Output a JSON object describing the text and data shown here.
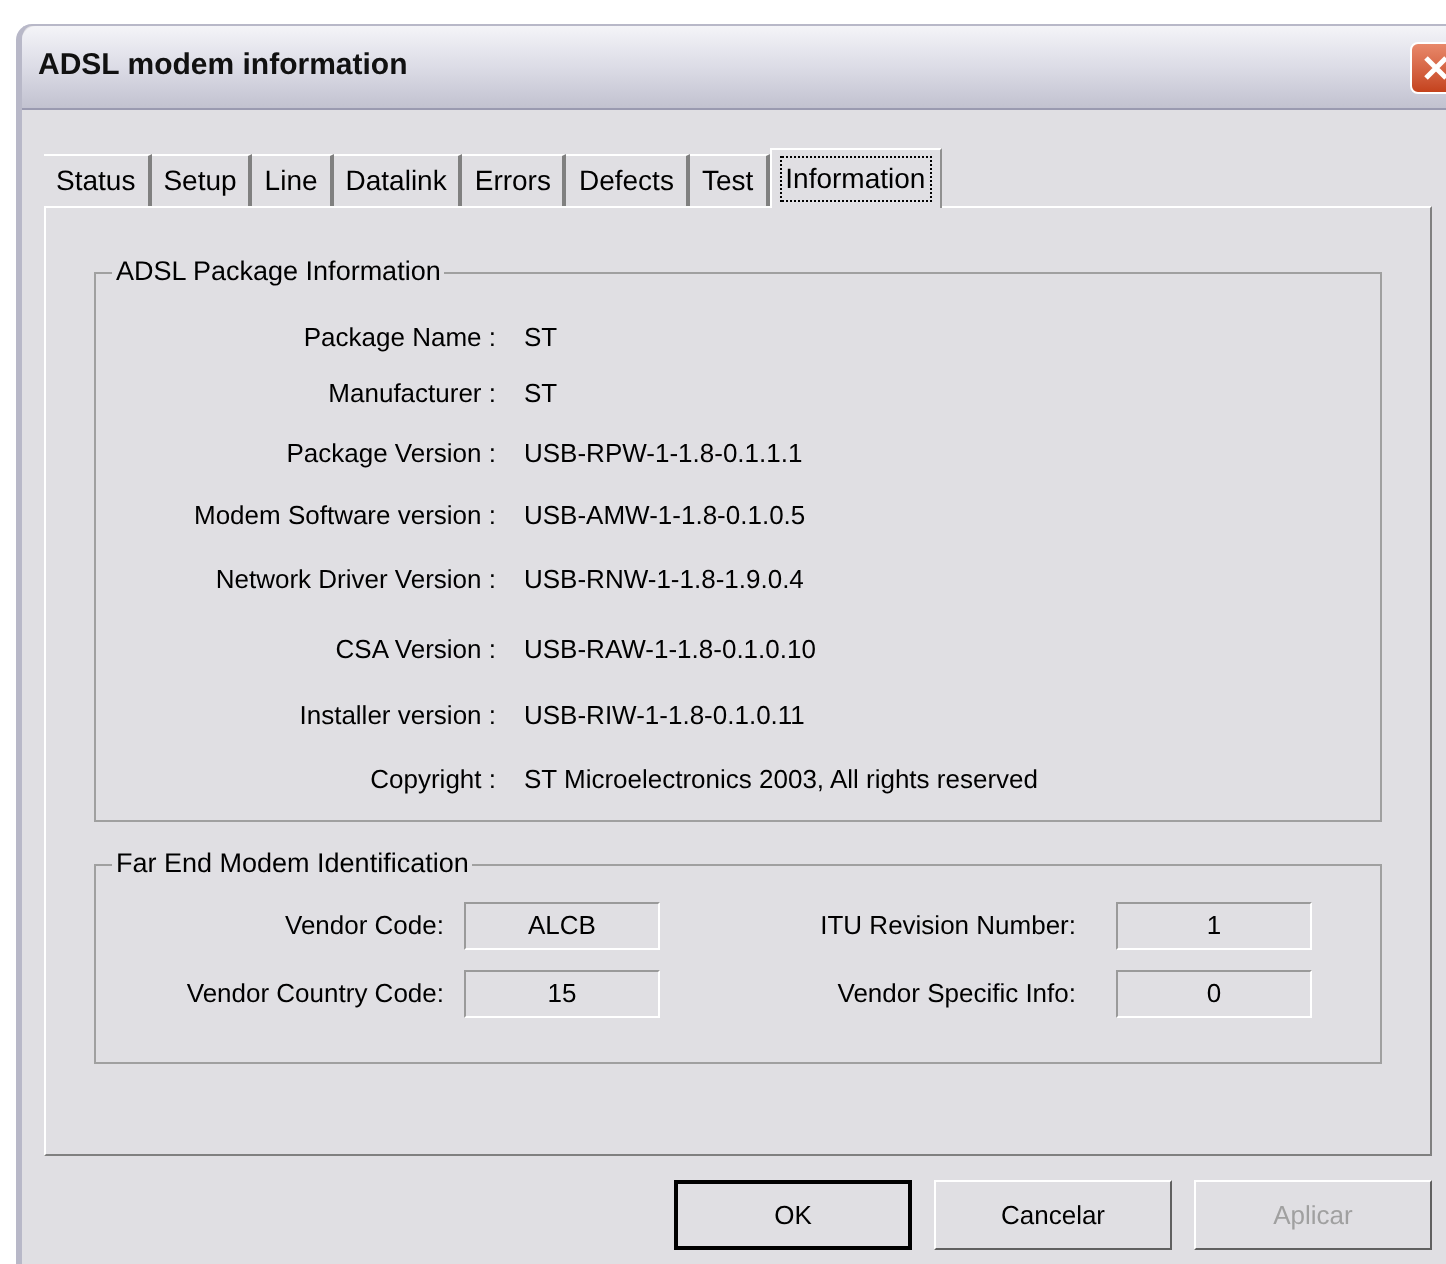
{
  "window": {
    "title": "ADSL modem information"
  },
  "tabs": [
    {
      "label": "Status",
      "selected": false
    },
    {
      "label": "Setup",
      "selected": false
    },
    {
      "label": "Line",
      "selected": false
    },
    {
      "label": "Datalink",
      "selected": false
    },
    {
      "label": "Errors",
      "selected": false
    },
    {
      "label": "Defects",
      "selected": false
    },
    {
      "label": "Test",
      "selected": false
    },
    {
      "label": "Information",
      "selected": true
    }
  ],
  "package_group": {
    "title": "ADSL Package Information",
    "rows": [
      {
        "label": "Package Name :",
        "value": "ST"
      },
      {
        "label": "Manufacturer :",
        "value": "ST"
      },
      {
        "label": "Package Version :",
        "value": "USB-RPW-1-1.8-0.1.1.1"
      },
      {
        "label": "Modem Software version :",
        "value": "USB-AMW-1-1.8-0.1.0.5"
      },
      {
        "label": "Network Driver Version :",
        "value": "USB-RNW-1-1.8-1.9.0.4"
      },
      {
        "label": "CSA Version :",
        "value": "USB-RAW-1-1.8-0.1.0.10"
      },
      {
        "label": "Installer version :",
        "value": "USB-RIW-1-1.8-0.1.0.11"
      },
      {
        "label": "Copyright :",
        "value": "ST Microelectronics 2003, All rights reserved"
      }
    ]
  },
  "far_end_group": {
    "title": "Far End Modem Identification",
    "fields": [
      {
        "label": "Vendor Code:",
        "value": "ALCB"
      },
      {
        "label": "ITU Revision Number:",
        "value": "1"
      },
      {
        "label": "Vendor Country Code:",
        "value": "15"
      },
      {
        "label": "Vendor Specific Info:",
        "value": "0"
      }
    ]
  },
  "buttons": [
    {
      "label": "OK",
      "default": true,
      "disabled": false
    },
    {
      "label": "Cancelar",
      "default": false,
      "disabled": false
    },
    {
      "label": "Aplicar",
      "default": false,
      "disabled": true
    }
  ]
}
